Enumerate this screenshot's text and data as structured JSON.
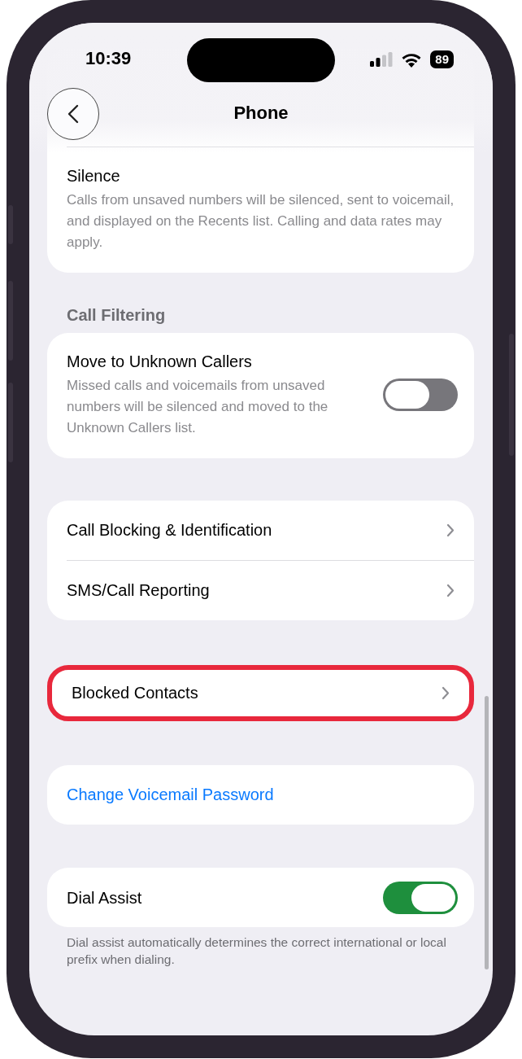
{
  "status_bar": {
    "time": "10:39",
    "battery": "89"
  },
  "nav": {
    "title": "Phone"
  },
  "sections": [
    {
      "rows": [
        {
          "kind": "option",
          "title": "Silence",
          "description": "Calls from unsaved numbers will be silenced, sent to voicemail, and displayed on the Recents list. Calling and data rates may apply."
        }
      ]
    },
    {
      "header": "Call Filtering",
      "rows": [
        {
          "kind": "toggle",
          "title": "Move to Unknown Callers",
          "description": "Missed calls and voicemails from unsaved numbers will be silenced and moved to the Unknown Callers list.",
          "on": false
        }
      ]
    },
    {
      "rows": [
        {
          "kind": "link",
          "title": "Call Blocking & Identification"
        },
        {
          "kind": "link",
          "title": "SMS/Call Reporting"
        }
      ]
    },
    {
      "highlighted": true,
      "rows": [
        {
          "kind": "link",
          "title": "Blocked Contacts"
        }
      ]
    },
    {
      "rows": [
        {
          "kind": "action",
          "title": "Change Voicemail Password"
        }
      ]
    },
    {
      "rows": [
        {
          "kind": "toggle",
          "title": "Dial Assist",
          "on": true
        }
      ],
      "footer": "Dial assist automatically determines the correct international or local prefix when dialing."
    }
  ]
}
